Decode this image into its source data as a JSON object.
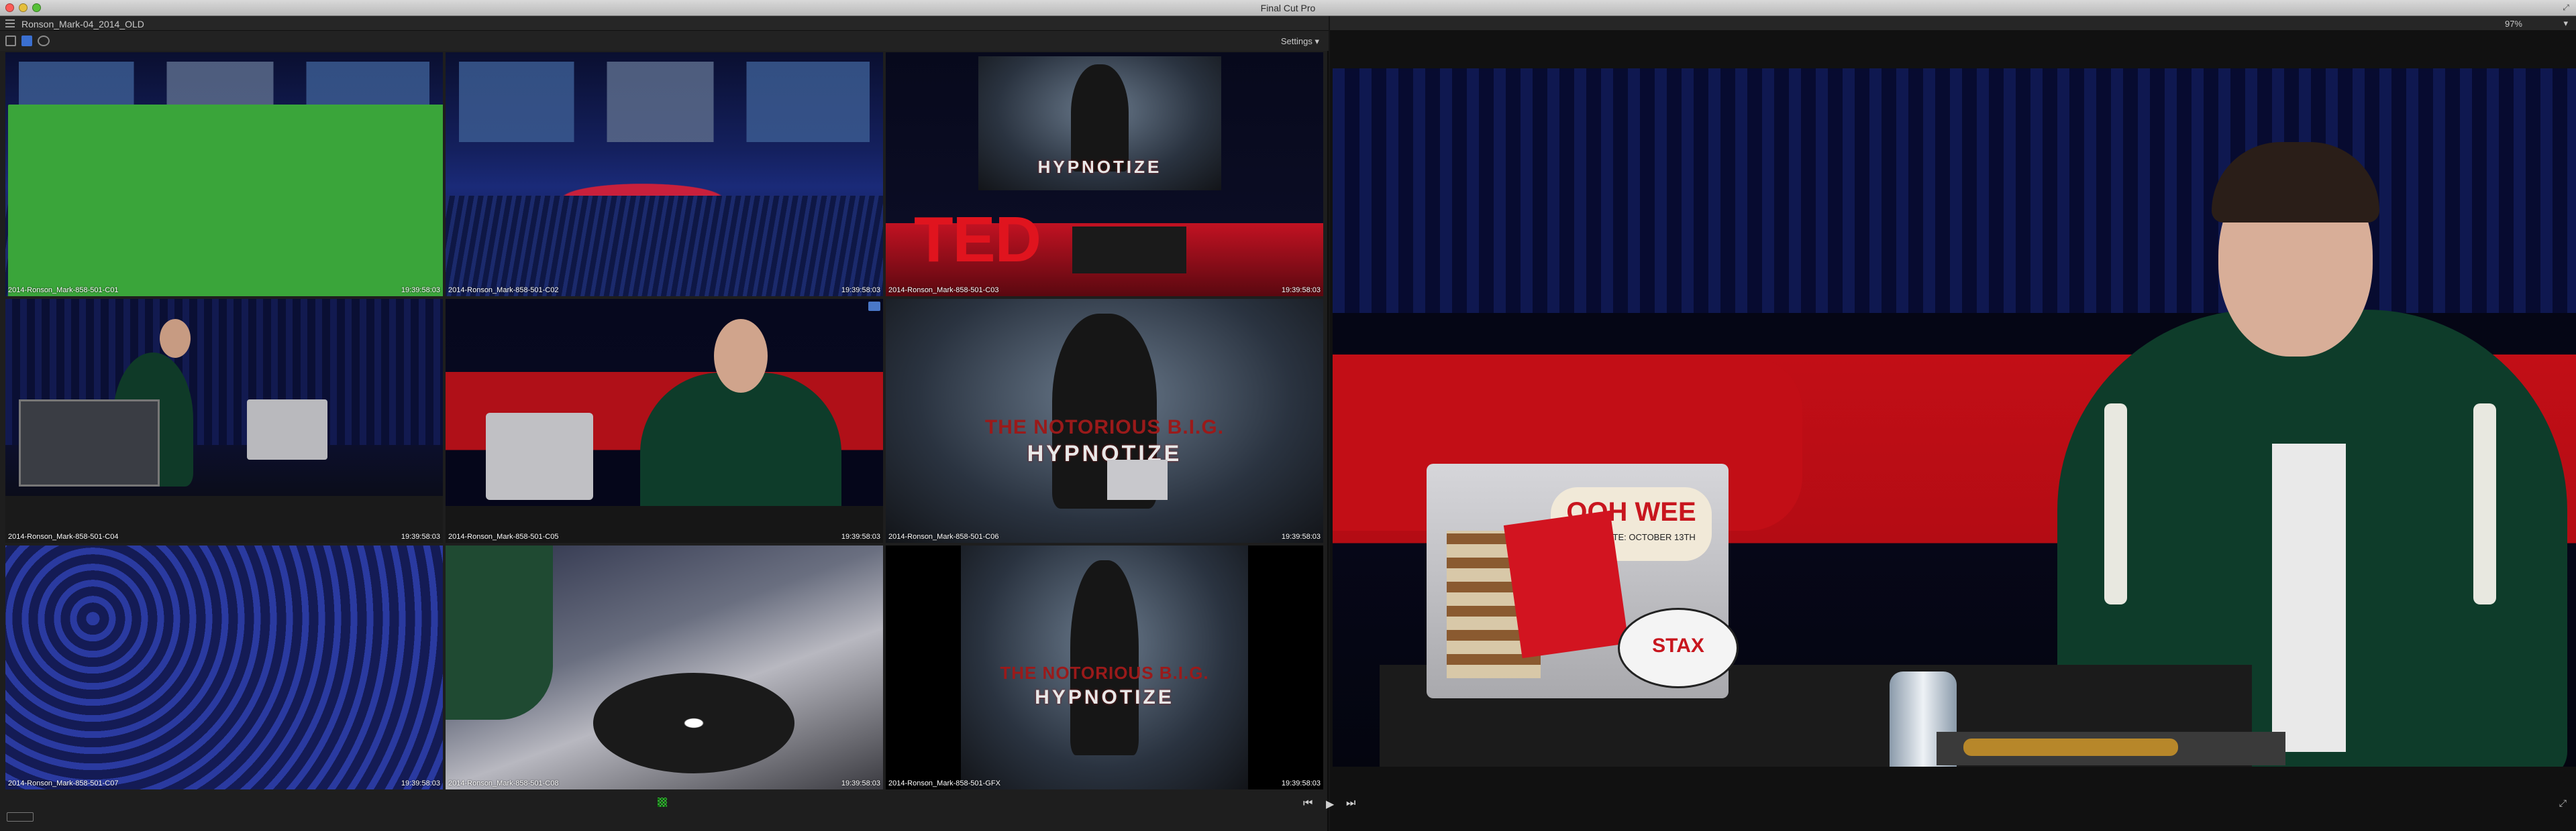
{
  "app": {
    "title": "Final Cut Pro"
  },
  "angle_viewer": {
    "clip_name": "Ronson_Mark-04_2014_OLD",
    "settings_label": "Settings",
    "settings_caret": "▾",
    "angles": [
      {
        "label": "2014-Ronson_Mark-858-501-C01",
        "timecode": "19:39:58:03"
      },
      {
        "label": "2014-Ronson_Mark-858-501-C02",
        "timecode": "19:39:58:03"
      },
      {
        "label": "2014-Ronson_Mark-858-501-C03",
        "timecode": "19:39:58:03"
      },
      {
        "label": "2014-Ronson_Mark-858-501-C04",
        "timecode": "19:39:58:03"
      },
      {
        "label": "2014-Ronson_Mark-858-501-C05",
        "timecode": "19:39:58:03"
      },
      {
        "label": "2014-Ronson_Mark-858-501-C06",
        "timecode": "19:39:58:03"
      },
      {
        "label": "2014-Ronson_Mark-858-501-C07",
        "timecode": "19:39:58:03"
      },
      {
        "label": "2014-Ronson_Mark-858-501-C08",
        "timecode": "19:39:58:03"
      },
      {
        "label": "2014-Ronson_Mark-858-501-GFX",
        "timecode": "19:39:58:03"
      }
    ],
    "ted_logo": "TED",
    "album_text": {
      "artist": "THE NOTORIOUS B.I.G.",
      "title": "HYPNOTIZE"
    }
  },
  "viewer": {
    "zoom": "97%",
    "view_menu": "▾",
    "laptop_sticker": "OOH WEE",
    "laptop_sticker_sub": "STREETDATE: OCTOBER 13TH",
    "stax_sticker": "STAX"
  },
  "transport": {
    "prev": "⏮",
    "play": "▶",
    "next": "⏭"
  },
  "colors": {
    "video_angle": "#3aa53a",
    "audio_angle": "#4a78c8"
  }
}
